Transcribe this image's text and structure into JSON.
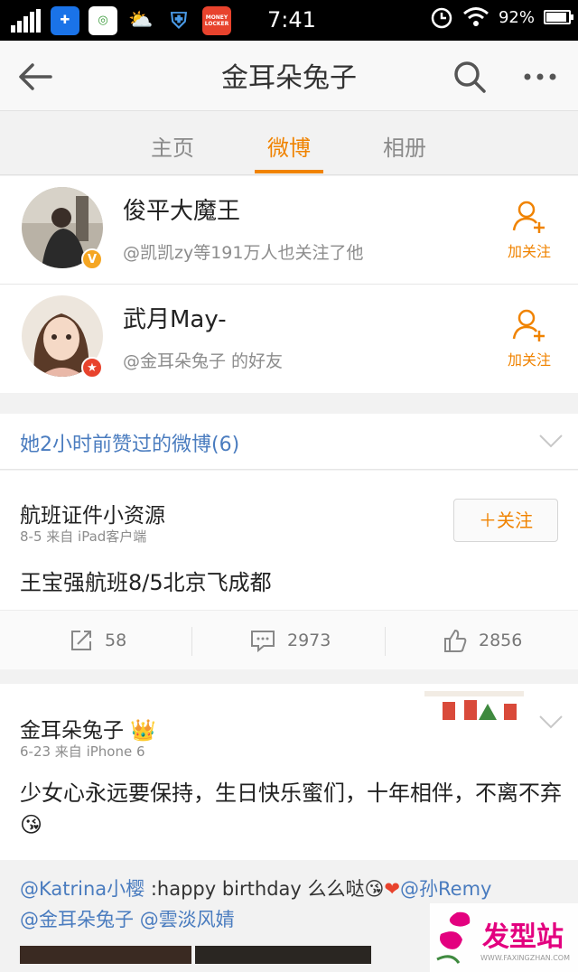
{
  "status_bar": {
    "time": "7:41",
    "battery": "92%",
    "battery_level": 0.92,
    "money_locker": "MONEY LOCKER"
  },
  "nav": {
    "title": "金耳朵兔子"
  },
  "tabs": [
    {
      "label": "主页",
      "active": false
    },
    {
      "label": "微博",
      "active": true
    },
    {
      "label": "相册",
      "active": false
    }
  ],
  "suggested_users": [
    {
      "name": "俊平大魔王",
      "desc": "@凯凯zy等191万人也关注了他",
      "badge": "V",
      "badge_color": "#f5a623",
      "follow_label": "加关注"
    },
    {
      "name": "武月May-",
      "desc": "@金耳朵兔子 的好友",
      "badge": "★",
      "badge_color": "#e8432d",
      "follow_label": "加关注"
    }
  ],
  "liked_header": "她2小时前赞过的微博(6)",
  "post1": {
    "author": "航班证件小资源",
    "meta": "8-5  来自 iPad客户端",
    "follow_label": "＋关注",
    "text": "王宝强航班8/5北京飞成都",
    "reposts": "58",
    "comments": "2973",
    "likes": "2856"
  },
  "post2": {
    "author": "金耳朵兔子",
    "meta": "6-23  来自 iPhone 6",
    "text": "少女心永远要保持，生日快乐蜜们，十年相伴，不离不弃",
    "repost_line1_mention": "@Katrina小樱",
    "repost_line1_text": " :happy birthday 么么哒",
    "repost_line1_mention2": "@孙Remy",
    "repost_line2_mention": "@金耳朵兔子",
    "repost_line2_mention2": "@雲淡风婧"
  },
  "watermark": {
    "text": "发型站",
    "url": "WWW.FAXINGZHAN.COM"
  },
  "colors": {
    "accent": "#f08300",
    "link": "#4a7cbf"
  }
}
